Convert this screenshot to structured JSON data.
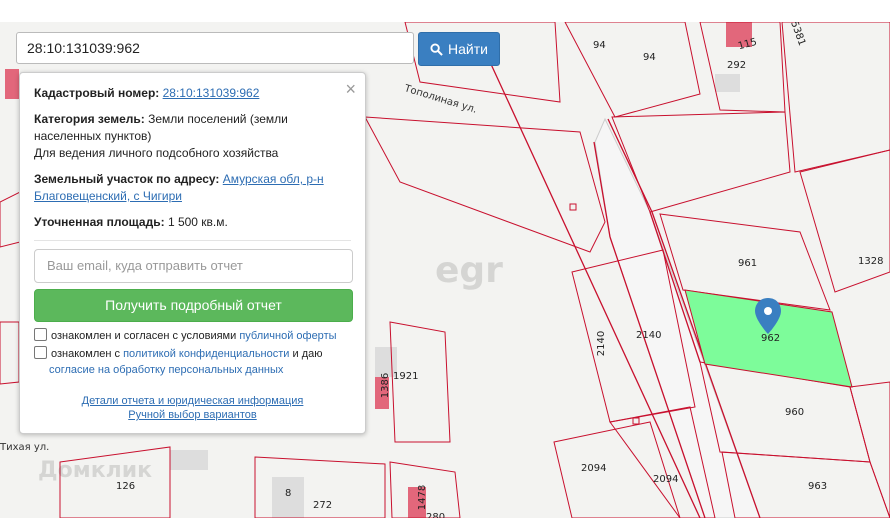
{
  "search": {
    "value": "28:10:131039:962",
    "button_label": "Найти"
  },
  "panel": {
    "cadastral_label": "Кадастровый номер:",
    "cadastral_value": "28:10:131039:962",
    "category_label": "Категория земель:",
    "category_value": "Земли поселений (земли населенных пунктов)",
    "use_value": "Для ведения личного подсобного хозяйства",
    "address_label": "Земельный участок по адресу:",
    "address_value": "Амурская обл, р-н Благовещенский, с Чигири",
    "area_label": "Уточненная площадь:",
    "area_value": "1 500 кв.м.",
    "email_placeholder": "Ваш email, куда отправить отчет",
    "submit_label": "Получить подробный отчет",
    "consent1_text": "ознакомлен и согласен с условиями",
    "consent1_link": "публичной оферты",
    "consent2_text_a": "ознакомлен с",
    "consent2_link_a": "политикой конфиденциальности",
    "consent2_text_b": "и даю",
    "consent2_link_b": "согласие на обработку персональных данных",
    "link_details": "Детали отчета и юридическая информация",
    "link_manual": "Ручной выбор вариантов"
  },
  "map": {
    "parcel_labels": [
      "94",
      "94",
      "115",
      "292",
      "5381",
      "961",
      "1328",
      "962",
      "960",
      "963",
      "2140",
      "2140",
      "2094",
      "2094",
      "1921",
      "1386",
      "126",
      "8",
      "272",
      "1478",
      "280"
    ],
    "streets": [
      "Тополиная ул.",
      "Тихая ул."
    ],
    "watermarks": [
      "Домклик",
      "egr"
    ],
    "selected_parcel": "962",
    "selected_color": "#7dfc9a",
    "parcel_line_color": "#c8102e"
  }
}
